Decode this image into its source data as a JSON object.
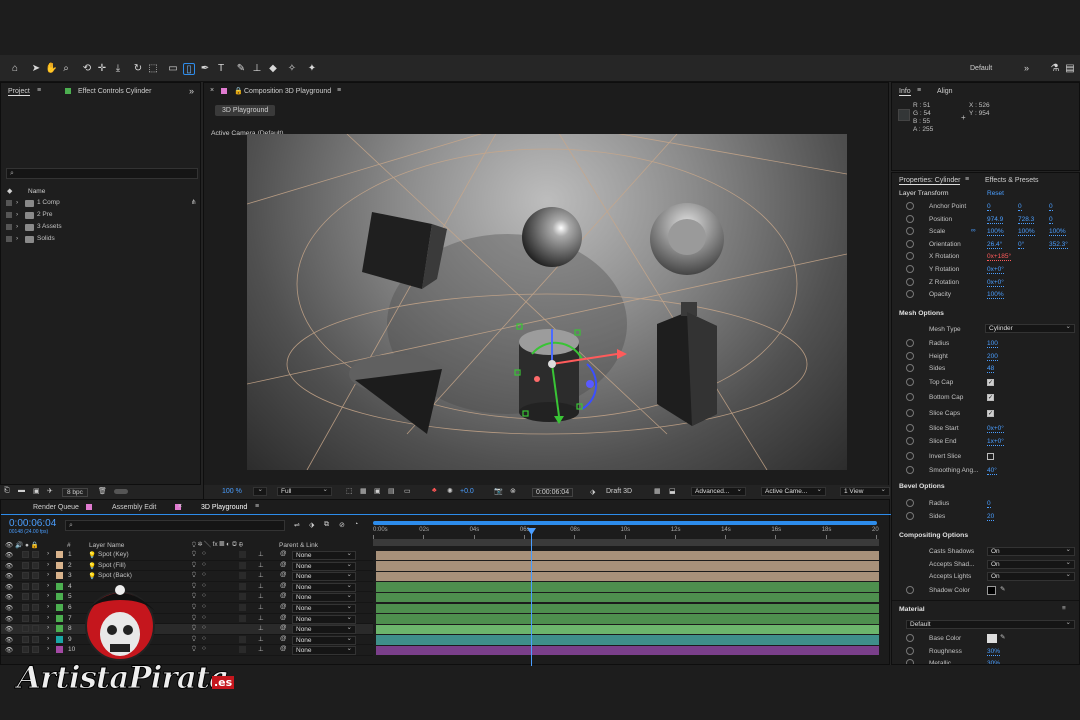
{
  "toolbar": {
    "workspace": "Default",
    "workspace_more": "»"
  },
  "project": {
    "tab": "Project",
    "effect_tab": "Effect Controls Cylinder",
    "search_placeholder": "",
    "col_name": "Name",
    "items": [
      "1 Comp",
      "2 Pre",
      "3 Assets",
      "Solids"
    ]
  },
  "project_bottom": {
    "bpc": "8 bpc"
  },
  "comp": {
    "tab": "Composition 3D Playground",
    "subtab": "3D Playground",
    "view_label": "Active Camera (Default)",
    "zoom": "100 %",
    "resolution": "Full",
    "exposure": "+0.0",
    "timecode": "0:00:06:04",
    "renderer": "Draft 3D",
    "advanced": "Advanced...",
    "camera": "Active Came...",
    "views": "1 View"
  },
  "info": {
    "tab": "Info",
    "align_tab": "Align",
    "r": "R : 51",
    "g": "G : 54",
    "b": "B : 55",
    "a": "A : 255",
    "x": "X : 526",
    "y": "Y : 954"
  },
  "props": {
    "tab": "Properties: Cylinder",
    "effects_tab": "Effects & Presets",
    "layer_transform": "Layer Transform",
    "reset": "Reset",
    "transform": [
      {
        "label": "Anchor Point",
        "v": [
          "0",
          "0",
          "0"
        ]
      },
      {
        "label": "Position",
        "v": [
          "974.9",
          "728.3",
          "0"
        ]
      },
      {
        "label": "Scale",
        "v": [
          "100%",
          "100%",
          "100%"
        ]
      },
      {
        "label": "Orientation",
        "v": [
          "26.4°",
          "0°",
          "352.3°"
        ]
      },
      {
        "label": "X Rotation",
        "v": [
          "0x+185°"
        ]
      },
      {
        "label": "Y Rotation",
        "v": [
          "0x+0°"
        ]
      },
      {
        "label": "Z Rotation",
        "v": [
          "0x+0°"
        ]
      },
      {
        "label": "Opacity",
        "v": [
          "100%"
        ]
      }
    ],
    "mesh_options": "Mesh Options",
    "mesh_type_label": "Mesh Type",
    "mesh_type": "Cylinder",
    "mesh": [
      {
        "label": "Radius",
        "v": "100"
      },
      {
        "label": "Height",
        "v": "200"
      },
      {
        "label": "Sides",
        "v": "48"
      }
    ],
    "caps": [
      {
        "label": "Top Cap"
      },
      {
        "label": "Bottom Cap"
      },
      {
        "label": "Slice Caps"
      }
    ],
    "slice": [
      {
        "label": "Slice Start",
        "v": "0x+0°"
      },
      {
        "label": "Slice End",
        "v": "1x+0°"
      }
    ],
    "invert_slice": "Invert Slice",
    "smoothing_label": "Smoothing Ang...",
    "smoothing": "40°",
    "bevel_options": "Bevel Options",
    "bevel": [
      {
        "label": "Radius",
        "v": "0"
      },
      {
        "label": "Sides",
        "v": "20"
      }
    ],
    "compositing_options": "Compositing Options",
    "compositing": [
      {
        "label": "Casts Shadows",
        "v": "On"
      },
      {
        "label": "Accepts Shad...",
        "v": "On"
      },
      {
        "label": "Accepts Lights",
        "v": "On"
      }
    ],
    "shadow_color": "Shadow Color",
    "material": "Material",
    "material_sel": "Default",
    "material_rows": [
      {
        "label": "Base Color"
      },
      {
        "label": "Roughness",
        "v": "30%"
      },
      {
        "label": "Metallic",
        "v": "30%"
      }
    ]
  },
  "timeline": {
    "tabs": [
      "Render Queue",
      "Assembly Edit",
      "3D Playground"
    ],
    "timecode": "0:00:06:04",
    "frames": "00148 (24.00 fps)",
    "col_num": "#",
    "col_layer": "Layer Name",
    "col_parent": "Parent & Link",
    "ticks": [
      "0:00s",
      "02s",
      "04s",
      "06s",
      "08s",
      "10s",
      "12s",
      "14s",
      "16s",
      "18s",
      "20"
    ],
    "layers": [
      {
        "n": "1",
        "name": "Spot (Key)",
        "color": "#d9b38c",
        "parent": "None",
        "bar": "#a8917a"
      },
      {
        "n": "2",
        "name": "Spot (Fill)",
        "color": "#d9b38c",
        "parent": "None",
        "bar": "#a8917a"
      },
      {
        "n": "3",
        "name": "Spot (Back)",
        "color": "#d9b38c",
        "parent": "None",
        "bar": "#a8917a"
      },
      {
        "n": "4",
        "name": "",
        "color": "#4caf50",
        "parent": "None",
        "bar": "#4e8f4e"
      },
      {
        "n": "5",
        "name": "",
        "color": "#4caf50",
        "parent": "None",
        "bar": "#4e8f4e"
      },
      {
        "n": "6",
        "name": "",
        "color": "#4caf50",
        "parent": "None",
        "bar": "#4e8f4e"
      },
      {
        "n": "7",
        "name": "",
        "color": "#4caf50",
        "parent": "None",
        "bar": "#4e8f4e"
      },
      {
        "n": "8",
        "name": "",
        "color": "#4caf50",
        "parent": "None",
        "bar": "#6cb56c"
      },
      {
        "n": "9",
        "name": "",
        "color": "#1aa6a6",
        "parent": "None",
        "bar": "#3f8f8a"
      },
      {
        "n": "10",
        "name": "",
        "color": "#a349a4",
        "parent": "None",
        "bar": "#7a3f8a"
      }
    ]
  },
  "watermark": {
    "text": "ArtistaPirata",
    "suffix": ".es"
  }
}
